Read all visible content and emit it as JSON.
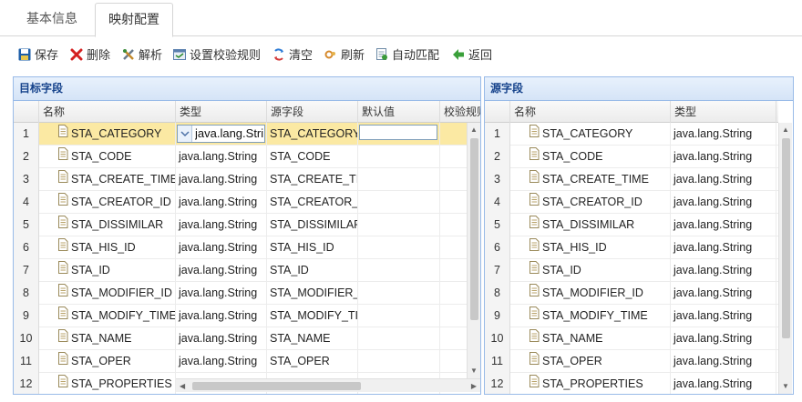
{
  "tabs": [
    {
      "label": "基本信息",
      "active": false
    },
    {
      "label": "映射配置",
      "active": true
    }
  ],
  "toolbar": {
    "save": "保存",
    "delete": "删除",
    "parse": "解析",
    "set_validation": "设置校验规则",
    "clear": "清空",
    "refresh": "刷新",
    "auto_match": "自动匹配",
    "back": "返回"
  },
  "left_panel": {
    "title": "目标字段",
    "columns": [
      "名称",
      "类型",
      "源字段",
      "默认值",
      "校验规则"
    ],
    "editing": {
      "type_value": "java.lang.String",
      "default_value": ""
    },
    "rows": [
      {
        "n": "1",
        "name": "STA_CATEGORY",
        "type": "java.lang.String",
        "source": "STA_CATEGORY",
        "default": ""
      },
      {
        "n": "2",
        "name": "STA_CODE",
        "type": "java.lang.String",
        "source": "STA_CODE",
        "default": ""
      },
      {
        "n": "3",
        "name": "STA_CREATE_TIME",
        "type": "java.lang.String",
        "source": "STA_CREATE_TIME",
        "default": ""
      },
      {
        "n": "4",
        "name": "STA_CREATOR_ID",
        "type": "java.lang.String",
        "source": "STA_CREATOR_ID",
        "default": ""
      },
      {
        "n": "5",
        "name": "STA_DISSIMILAR",
        "type": "java.lang.String",
        "source": "STA_DISSIMILAR",
        "default": ""
      },
      {
        "n": "6",
        "name": "STA_HIS_ID",
        "type": "java.lang.String",
        "source": "STA_HIS_ID",
        "default": ""
      },
      {
        "n": "7",
        "name": "STA_ID",
        "type": "java.lang.String",
        "source": "STA_ID",
        "default": ""
      },
      {
        "n": "8",
        "name": "STA_MODIFIER_ID",
        "type": "java.lang.String",
        "source": "STA_MODIFIER_ID",
        "default": ""
      },
      {
        "n": "9",
        "name": "STA_MODIFY_TIME",
        "type": "java.lang.String",
        "source": "STA_MODIFY_TIME",
        "default": ""
      },
      {
        "n": "10",
        "name": "STA_NAME",
        "type": "java.lang.String",
        "source": "STA_NAME",
        "default": ""
      },
      {
        "n": "11",
        "name": "STA_OPER",
        "type": "java.lang.String",
        "source": "STA_OPER",
        "default": ""
      },
      {
        "n": "12",
        "name": "STA_PROPERTIES",
        "type": "",
        "source": "",
        "default": ""
      }
    ]
  },
  "right_panel": {
    "title": "源字段",
    "columns": [
      "名称",
      "类型"
    ],
    "rows": [
      {
        "n": "1",
        "name": "STA_CATEGORY",
        "type": "java.lang.String"
      },
      {
        "n": "2",
        "name": "STA_CODE",
        "type": "java.lang.String"
      },
      {
        "n": "3",
        "name": "STA_CREATE_TIME",
        "type": "java.lang.String"
      },
      {
        "n": "4",
        "name": "STA_CREATOR_ID",
        "type": "java.lang.String"
      },
      {
        "n": "5",
        "name": "STA_DISSIMILAR",
        "type": "java.lang.String"
      },
      {
        "n": "6",
        "name": "STA_HIS_ID",
        "type": "java.lang.String"
      },
      {
        "n": "7",
        "name": "STA_ID",
        "type": "java.lang.String"
      },
      {
        "n": "8",
        "name": "STA_MODIFIER_ID",
        "type": "java.lang.String"
      },
      {
        "n": "9",
        "name": "STA_MODIFY_TIME",
        "type": "java.lang.String"
      },
      {
        "n": "10",
        "name": "STA_NAME",
        "type": "java.lang.String"
      },
      {
        "n": "11",
        "name": "STA_OPER",
        "type": "java.lang.String"
      },
      {
        "n": "12",
        "name": "STA_PROPERTIES",
        "type": "java.lang.String"
      }
    ]
  },
  "colors": {
    "panel_border": "#99bbe8",
    "panel_title": "#15428b",
    "selected_row": "#fbe9a3"
  }
}
